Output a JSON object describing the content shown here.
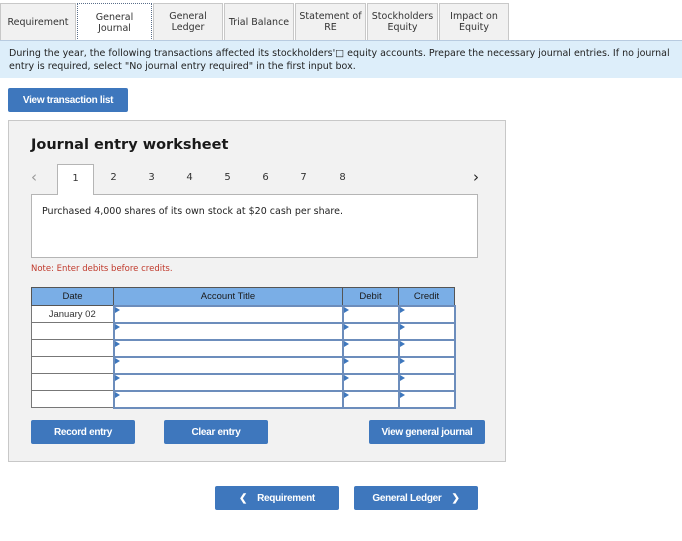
{
  "tabs": [
    {
      "label": "Requirement",
      "active": false
    },
    {
      "label": "General\nJournal",
      "active": true
    },
    {
      "label": "General\nLedger",
      "active": false
    },
    {
      "label": "Trial Balance",
      "active": false
    },
    {
      "label": "Statement of\nRE",
      "active": false
    },
    {
      "label": "Stockholders\nEquity",
      "active": false
    },
    {
      "label": "Impact on\nEquity",
      "active": false
    }
  ],
  "instruction": "During the year, the following transactions affected its stockholders'□ equity accounts.  Prepare the necessary journal entries.  If no journal entry is required, select \"No journal entry required\" in the first input box.",
  "view_transaction_list_label": "View transaction list",
  "worksheet": {
    "title": "Journal entry worksheet",
    "prev_icon": "chevron-left-icon",
    "next_icon": "chevron-right-icon",
    "pages": [
      "1",
      "2",
      "3",
      "4",
      "5",
      "6",
      "7",
      "8"
    ],
    "active_page": "1",
    "description": "Purchased 4,000 shares of its own stock at $20 cash per share.",
    "note": "Note: Enter debits before credits.",
    "columns": {
      "date": "Date",
      "account": "Account Title",
      "debit": "Debit",
      "credit": "Credit"
    },
    "rows": [
      {
        "date": "January 02",
        "account": "",
        "debit": "",
        "credit": ""
      },
      {
        "date": "",
        "account": "",
        "debit": "",
        "credit": ""
      },
      {
        "date": "",
        "account": "",
        "debit": "",
        "credit": ""
      },
      {
        "date": "",
        "account": "",
        "debit": "",
        "credit": ""
      },
      {
        "date": "",
        "account": "",
        "debit": "",
        "credit": ""
      },
      {
        "date": "",
        "account": "",
        "debit": "",
        "credit": ""
      }
    ],
    "record_entry_label": "Record entry",
    "clear_entry_label": "Clear entry",
    "view_general_journal_label": "View general journal"
  },
  "nav": {
    "prev_label": "Requirement",
    "next_label": "General Ledger"
  },
  "colors": {
    "button": "#3e77bd",
    "table_header": "#7aaee6",
    "instruction_bg": "#ddeefa",
    "note": "#c0392b"
  }
}
